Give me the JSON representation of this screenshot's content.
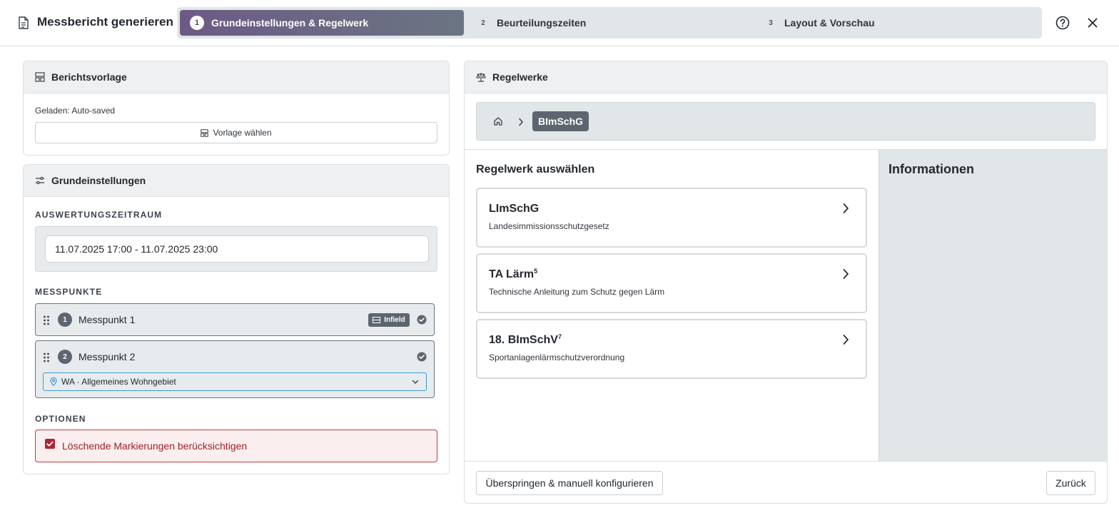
{
  "header": {
    "title": "Messbericht generieren",
    "steps": [
      {
        "num": "1",
        "label": "Grundeinstellungen & Regelwerk",
        "active": true
      },
      {
        "num": "2",
        "label": "Beurteilungszeiten",
        "active": false
      },
      {
        "num": "3",
        "label": "Layout & Vorschau",
        "active": false
      }
    ],
    "help_icon": "help-circle-icon",
    "close_icon": "close-icon"
  },
  "template_card": {
    "title": "Berichtsvorlage",
    "loaded_text": "Geladen: Auto-saved",
    "choose_button": "Vorlage wählen"
  },
  "settings_card": {
    "title": "Grundeinstellungen",
    "period_label": "AUSWERTUNGSZEITRAUM",
    "period_value": "11.07.2025 17:00 - 11.07.2025 23:00",
    "points_label": "MESSPUNKTE",
    "points": [
      {
        "num": "1",
        "name": "Messpunkt 1",
        "tag": "Infield"
      },
      {
        "num": "2",
        "name": "Messpunkt 2",
        "zone": "WA · Allgemeines Wohngebiet"
      }
    ],
    "options_label": "OPTIONEN",
    "option_text": "Löschende Markierungen berücksichtigen",
    "option_checked": true
  },
  "rules_card": {
    "title": "Regelwerke",
    "breadcrumb_current": "BImSchG",
    "select_title": "Regelwerk auswählen",
    "info_title": "Informationen",
    "items": [
      {
        "title": "LImSchG",
        "sup": "",
        "desc": "Landesimmissionsschutzgesetz"
      },
      {
        "title": "TA Lärm",
        "sup": "5",
        "desc": "Technische Anleitung zum Schutz gegen Lärm"
      },
      {
        "title": "18. BImSchV",
        "sup": "7",
        "desc": "Sportanlagenlärmschutzverordnung"
      }
    ],
    "skip_button": "Überspringen & manuell konfigurieren",
    "back_button": "Zurück"
  },
  "colors": {
    "accent_gradient_start": "#6c5a86",
    "accent_gradient_end": "#6b7582",
    "danger": "#c8363f",
    "focus": "#3a9ccf"
  }
}
